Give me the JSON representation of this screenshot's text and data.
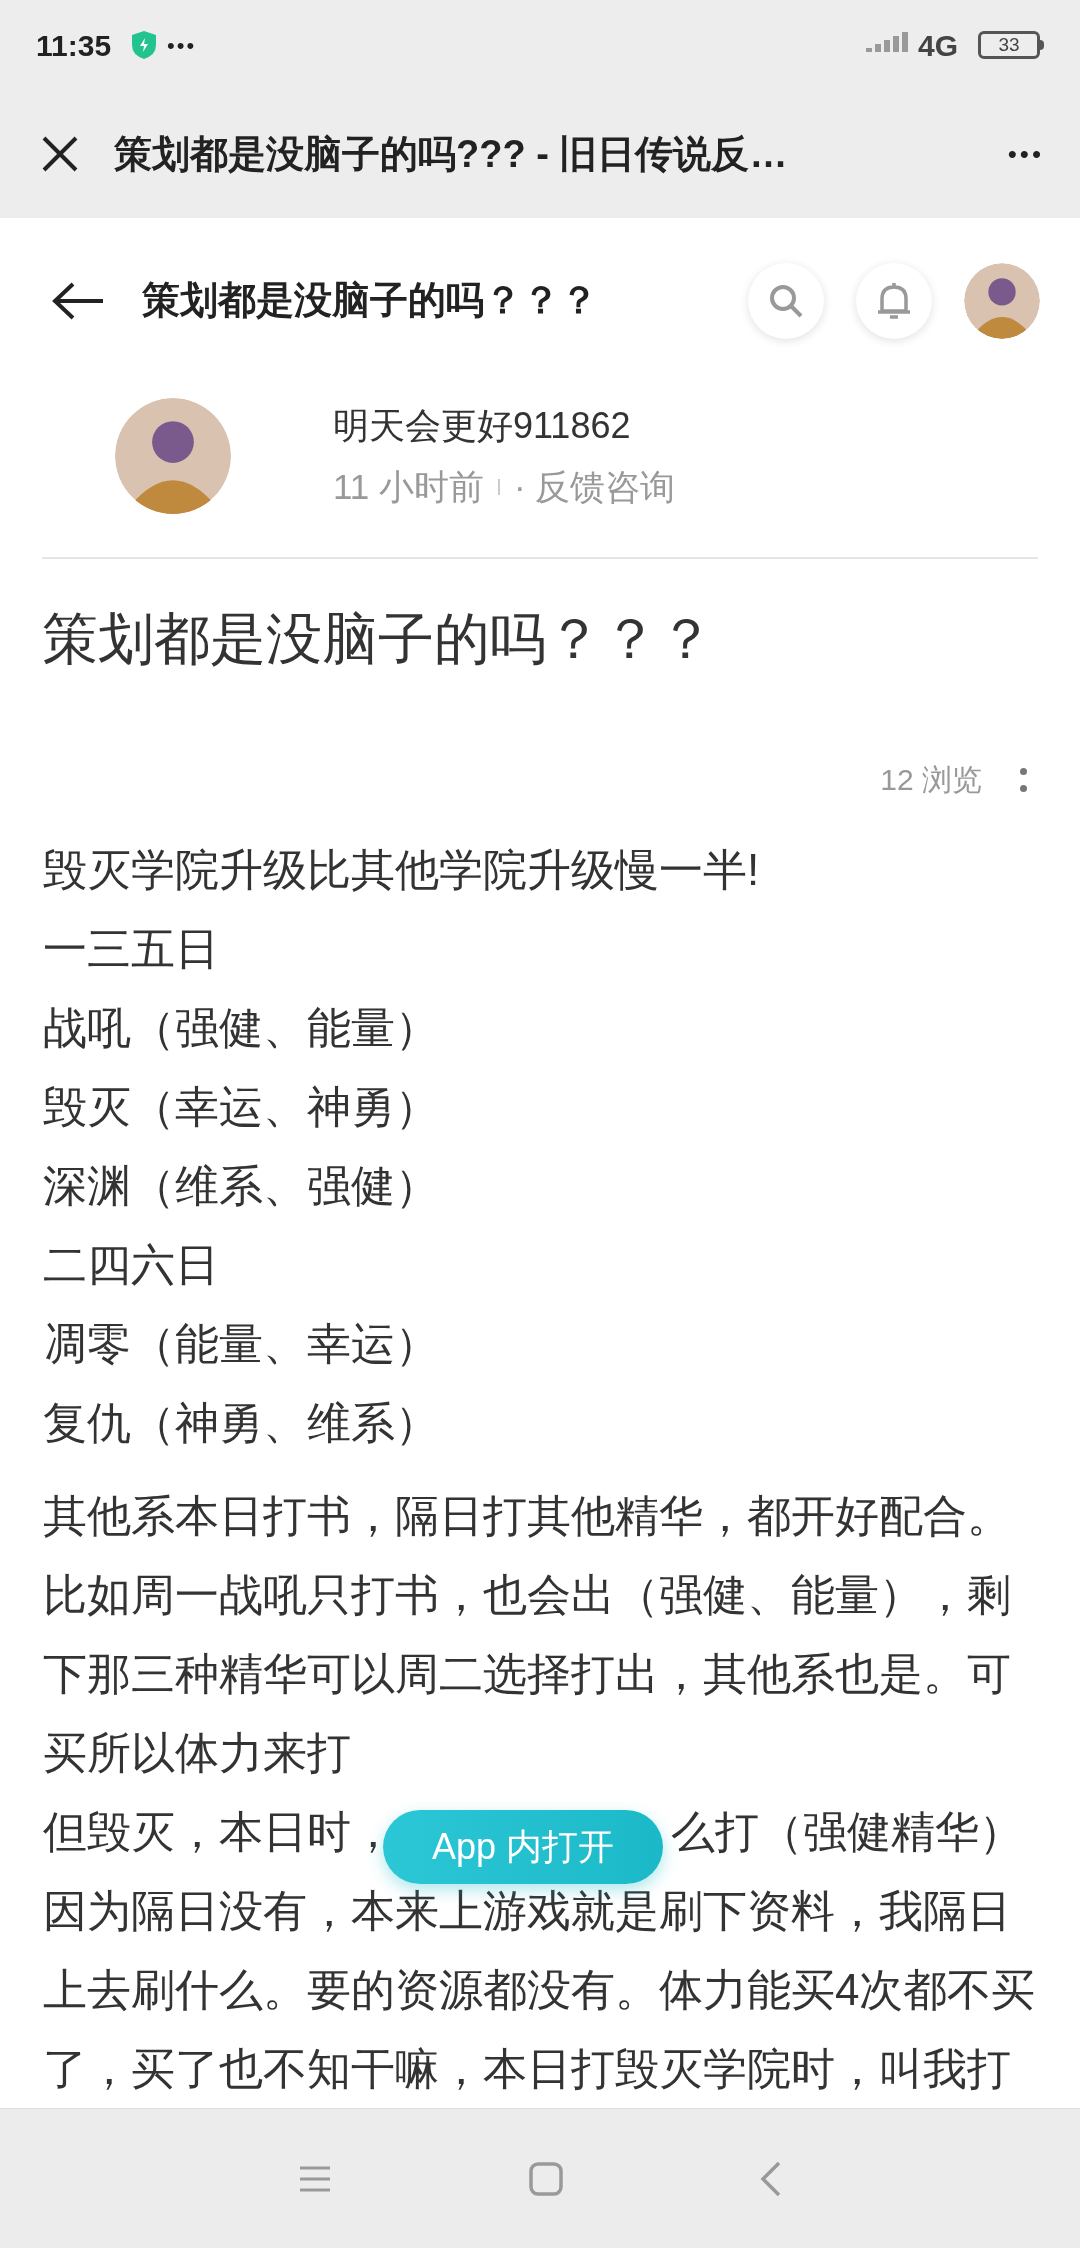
{
  "status_bar": {
    "time": "11:35",
    "notification_more": "•••",
    "network": "4G",
    "battery": "33"
  },
  "browser_bar": {
    "title": "策划都是没脑子的吗??? - 旧日传说反…",
    "more": "•••"
  },
  "header": {
    "title": "策划都是没脑子的吗？？？"
  },
  "author": {
    "name": "明天会更好911862",
    "time": "11 小时前",
    "category": "· 反馈咨询"
  },
  "post": {
    "title": "策划都是没脑子的吗？？？",
    "views": "12 浏览",
    "lines": [
      {
        "kind": "line",
        "text": "毁灭学院升级比其他学院升级慢一半!"
      },
      {
        "kind": "line",
        "text": "一三五日"
      },
      {
        "kind": "line",
        "text": "战吼（强健、能量）"
      },
      {
        "kind": "line",
        "text": "毁灭（幸运、神勇）"
      },
      {
        "kind": "line",
        "text": "深渊（维系、强健）"
      },
      {
        "kind": "line",
        "text": "二四六日"
      },
      {
        "kind": "line",
        "text": "凋零（能量、幸运）"
      },
      {
        "kind": "line",
        "text": "复仇（神勇、维系）"
      },
      {
        "kind": "gap"
      },
      {
        "kind": "line",
        "text": "其他系本日打书，隔日打其他精华，都开好配合。"
      },
      {
        "kind": "line",
        "text": "比如周一战吼只打书，也会出（强健、能量），剩"
      },
      {
        "kind": "line",
        "text": "下那三种精华可以周二选择打出，其他系也是。可"
      },
      {
        "kind": "line",
        "text": "买所以体力来打"
      },
      {
        "kind": "split",
        "left": "但毁灭，本日时，",
        "right": "么打（强健精华）"
      },
      {
        "kind": "line",
        "text": "因为隔日没有，本来上游戏就是刷下资料，我隔日"
      },
      {
        "kind": "line",
        "text": "上去刷什么。要的资源都没有。体力能买4次都不买"
      },
      {
        "kind": "line",
        "text": "了，买了也不知干嘛，本日打毁灭学院时，叫我打"
      }
    ]
  },
  "open_in_app_button": "App 内打开"
}
